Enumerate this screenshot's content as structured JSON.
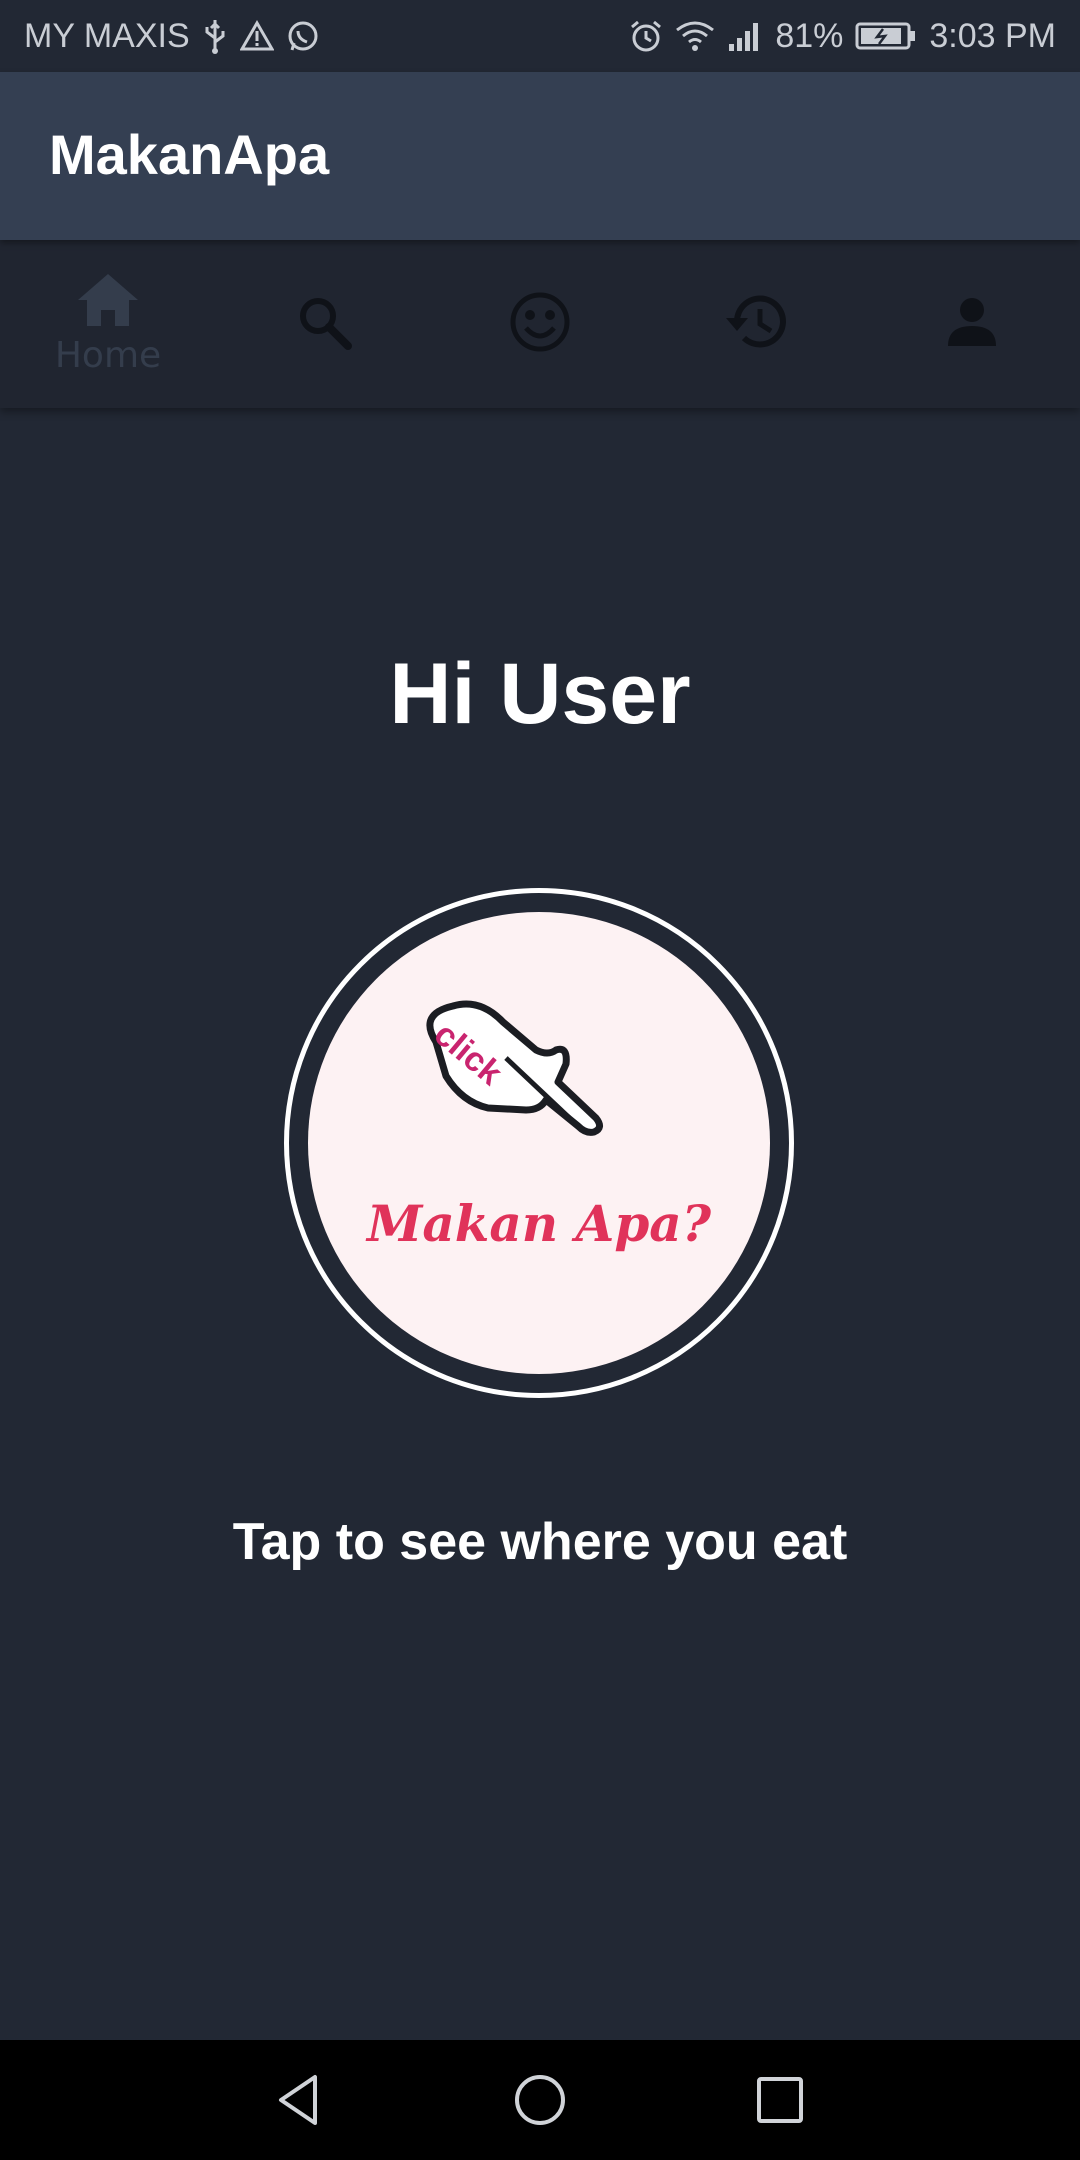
{
  "status_bar": {
    "carrier": "MY MAXIS",
    "battery": "81%",
    "time": "3:03 PM",
    "icons_left": [
      "usb-icon",
      "warning-icon",
      "whatsapp-icon"
    ],
    "icons_right": [
      "alarm-icon",
      "wifi-icon",
      "signal-icon",
      "battery-icon"
    ]
  },
  "app_bar": {
    "title": "MakanApa"
  },
  "tabs": [
    {
      "icon": "home-icon",
      "label": "Home",
      "selected": true
    },
    {
      "icon": "search-icon",
      "label": "",
      "selected": false
    },
    {
      "icon": "smiley-icon",
      "label": "",
      "selected": false
    },
    {
      "icon": "history-icon",
      "label": "",
      "selected": false
    },
    {
      "icon": "person-icon",
      "label": "",
      "selected": false
    }
  ],
  "main": {
    "greeting": "Hi User",
    "button": {
      "hand_text": "click",
      "logo_text": "Makan Apa?",
      "accent": "#e0335a"
    },
    "instruction": "Tap to see where you eat"
  },
  "nav_bar": {
    "buttons": [
      "back-icon",
      "home-circle-icon",
      "recents-icon"
    ]
  },
  "colors": {
    "background": "#222834",
    "app_bar": "#343f52",
    "tab_bar": "#202530",
    "text": "#ffffff"
  }
}
